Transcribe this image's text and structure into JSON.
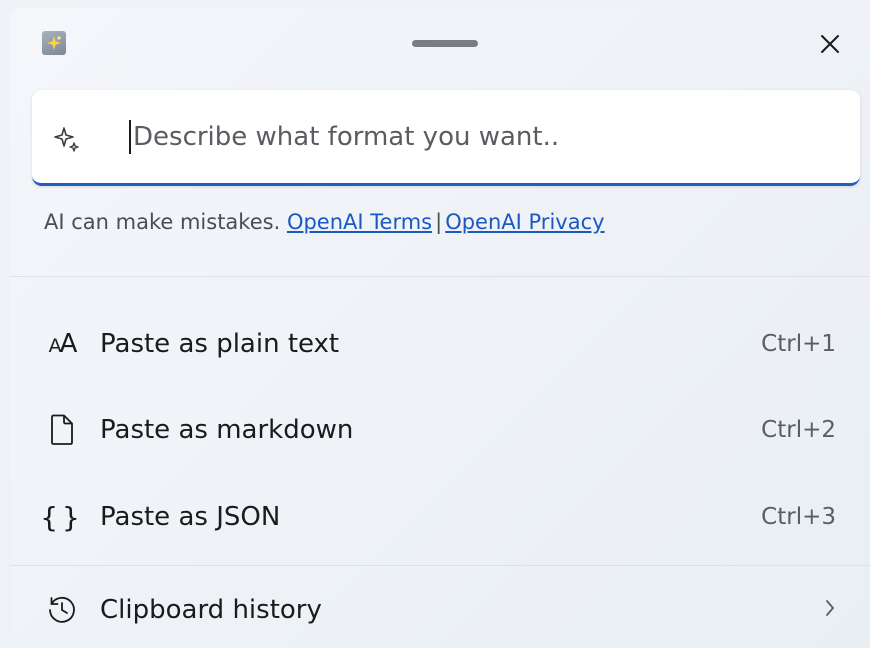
{
  "titlebar": {
    "app_icon": "paste-sparkle-icon",
    "close_icon": "close-icon"
  },
  "prompt": {
    "icon": "sparkle-icon",
    "placeholder": "Describe what format you want..",
    "value": ""
  },
  "disclaimer": {
    "text": "AI can make mistakes.",
    "terms_link": "OpenAI Terms",
    "separator": "|",
    "privacy_link": "OpenAI Privacy",
    "link_color": "#1a58c4"
  },
  "menu": {
    "items": [
      {
        "icon": "font-size-icon",
        "label": "Paste as plain text",
        "shortcut": "Ctrl+1"
      },
      {
        "icon": "document-icon",
        "label": "Paste as markdown",
        "shortcut": "Ctrl+2"
      },
      {
        "icon": "braces-icon",
        "label": "Paste as JSON",
        "shortcut": "Ctrl+3"
      }
    ],
    "history": {
      "icon": "history-icon",
      "label": "Clipboard history",
      "chevron": "chevron-right-icon"
    }
  },
  "colors": {
    "accent": "#1f5fbf",
    "background": "#eef2f7"
  }
}
